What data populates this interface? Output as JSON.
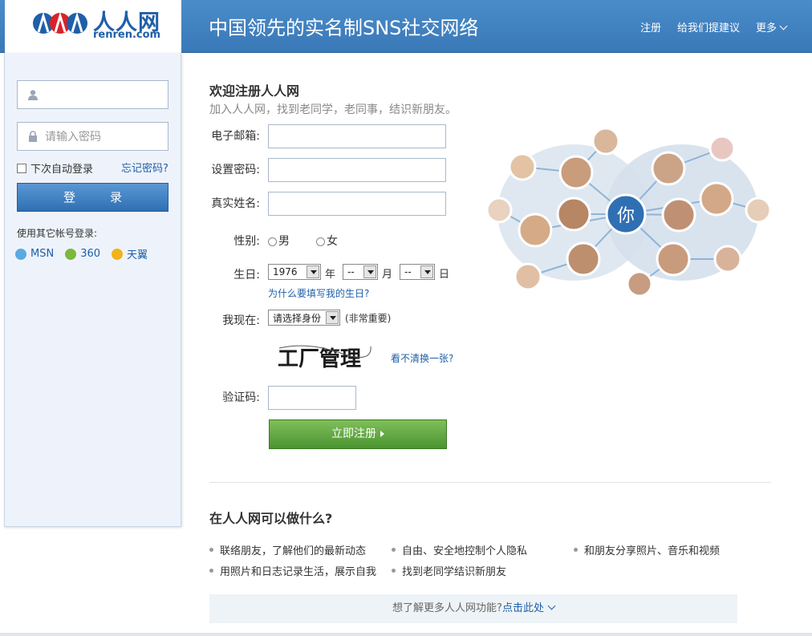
{
  "header": {
    "logo_text": "人人网",
    "logo_domain": "renren.com",
    "slogan": "中国领先的实名制SNS社交网络",
    "nav": [
      "注册",
      "给我们提建议",
      "更多"
    ]
  },
  "login": {
    "username_value": "",
    "password_placeholder": "请输入密码",
    "remember_label": "下次自动登录",
    "forgot_label": "忘记密码?",
    "login_button": "登　录",
    "other_title": "使用其它帐号登录:",
    "providers": [
      "MSN",
      "360",
      "天翼"
    ]
  },
  "register": {
    "welcome": "欢迎注册人人网",
    "subtitle": "加入人人网，找到老同学，老同事，结识新朋友。",
    "email_label": "电子邮箱:",
    "password_label": "设置密码:",
    "realname_label": "真实姓名:",
    "gender_label": "性别:",
    "gender_male": "男",
    "gender_female": "女",
    "birthday_label": "生日:",
    "year_value": "1976",
    "year_unit": "年",
    "month_value": "--",
    "month_unit": "月",
    "day_value": "--",
    "day_unit": "日",
    "why_birthday": "为什么要填写我的生日?",
    "status_label": "我现在:",
    "status_value": "请选择身份",
    "status_note": "(非常重要)",
    "captcha_text": "工厂管理",
    "captcha_refresh": "看不清换一张?",
    "captcha_label": "验证码:",
    "submit_button": "立即注册"
  },
  "illustration": {
    "center_label": "你"
  },
  "features": {
    "title": "在人人网可以做什么?",
    "items": [
      "联络朋友，了解他们的最新动态",
      "自由、安全地控制个人隐私",
      "和朋友分享照片、音乐和视频",
      "用照片和日志记录生活，展示自我",
      "找到老同学结识新朋友"
    ],
    "more_prefix": "想了解更多人人网功能?",
    "more_link": "点击此处"
  },
  "colors": {
    "brand_blue": "#3a78b8",
    "link_blue": "#1f5fa8",
    "register_green": "#4b9431"
  }
}
